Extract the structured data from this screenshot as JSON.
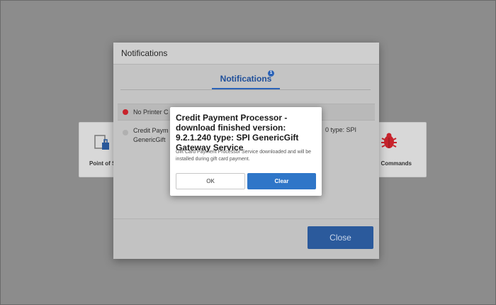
{
  "background": {
    "tiles": [
      {
        "label": "Point of S",
        "icon": "register-icon"
      },
      {
        "label": "g Commands",
        "icon": "bug-icon"
      }
    ]
  },
  "notifications_dialog": {
    "title": "Notifications",
    "tab": {
      "label": "Notifications",
      "badge": "1"
    },
    "rows": [
      {
        "text": "No Printer C",
        "status_color": "#c8232c"
      },
      {
        "text_left": "Credit Paym\nGenericGift",
        "text_right": "0 type: SPI",
        "status_color": "#b0b0b0"
      }
    ],
    "close_label": "Close"
  },
  "modal": {
    "title": "Credit Payment Processor  - download finished version: 9.2.1.240 type: SPI GenericGift Gateway Service",
    "message": "Gift Card Payment Processor Service downloaded and will be installed during gift card payment.",
    "ok_label": "OK",
    "clear_label": "Clear"
  },
  "colors": {
    "accent": "#2f76c8",
    "close_button": "#2b5a9c",
    "alert_red": "#c8232c"
  }
}
